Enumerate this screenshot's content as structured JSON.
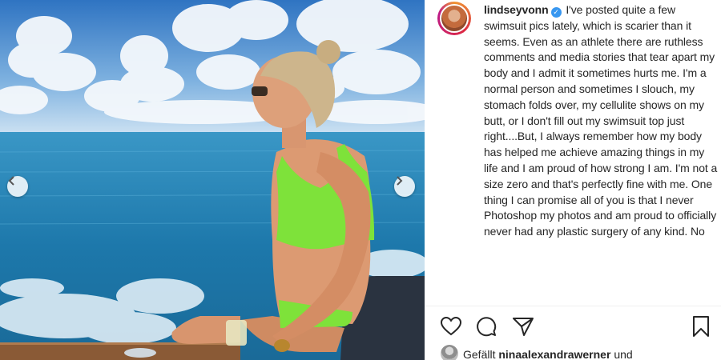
{
  "photo": {
    "alt_subject": "woman in green bikini on boat",
    "prev_icon": "chevron-left-icon",
    "next_icon": "chevron-right-icon"
  },
  "post": {
    "username": "lindseyvonn",
    "verified_icon": "verified-badge-icon",
    "caption": "I've posted quite a few swimsuit pics lately, which is scarier than it seems. Even as an athlete there are ruthless comments and media stories that tear apart my body and I admit it sometimes hurts me. I'm a normal person and sometimes I slouch, my stomach folds over, my cellulite shows on my butt, or I don't fill out my swimsuit top just right....But, I always remember how my body has helped me achieve amazing things in my life and I am proud of how strong I am.  I'm not a size zero and that's perfectly fine with me. One thing I can promise all of you is that I never Photoshop my photos and am proud to officially never had any plastic surgery of any kind. No"
  },
  "actions": {
    "like_icon": "heart-icon",
    "comment_icon": "comment-icon",
    "share_icon": "send-icon",
    "save_icon": "bookmark-icon"
  },
  "likes": {
    "prefix": "Gefällt",
    "user": "ninaalexandrawerner",
    "suffix": "und"
  },
  "colors": {
    "verified": "#3897f0",
    "text": "#262626",
    "bikini": "#7ee23a"
  }
}
